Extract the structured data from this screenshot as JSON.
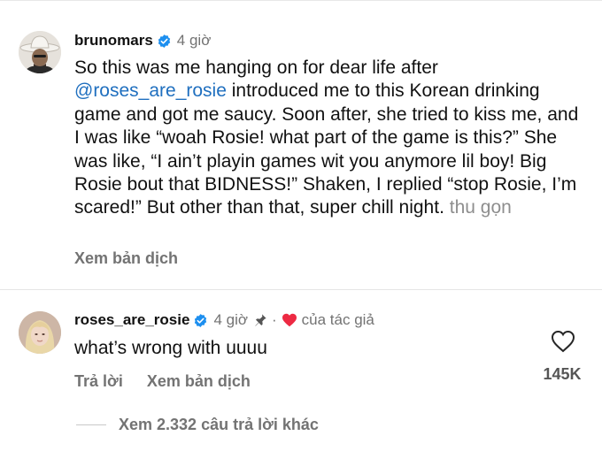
{
  "comment": {
    "username": "brunomars",
    "time": "4 giờ",
    "mention": "@roses_are_rosie",
    "text_before_mention": "So this was me hanging on for dear life after ",
    "text_after_mention": " introduced me to this Korean drinking game and got me saucy. Soon after, she tried to kiss me, and I was like “woah Rosie! what part of the game is this?” She was like, “I ain’t playin games wit you anymore lil boy! Big Rosie bout that BIDNESS!” Shaken, I replied “stop Rosie, I’m scared!” But other than that, super chill night.",
    "collapse_label": "thu gọn",
    "translate_label": "Xem bản dịch",
    "avatar_icon": "user-avatar-cowboy-hat"
  },
  "reply": {
    "username": "roses_are_rosie",
    "time": "4 giờ",
    "pin_icon": "pin-icon",
    "separator": "·",
    "author_like_label": "của tác giả",
    "text": "what’s wrong with uuuu",
    "reply_label": "Trả lời",
    "translate_label": "Xem bản dịch",
    "like_count": "145K",
    "avatar_icon": "user-avatar"
  },
  "more_replies": {
    "label": "Xem 2.332 câu trả lời khác"
  },
  "colors": {
    "verified": "#1d8fef",
    "mention": "#1f6fbf",
    "heart": "#ed2a43",
    "muted": "#737373"
  }
}
